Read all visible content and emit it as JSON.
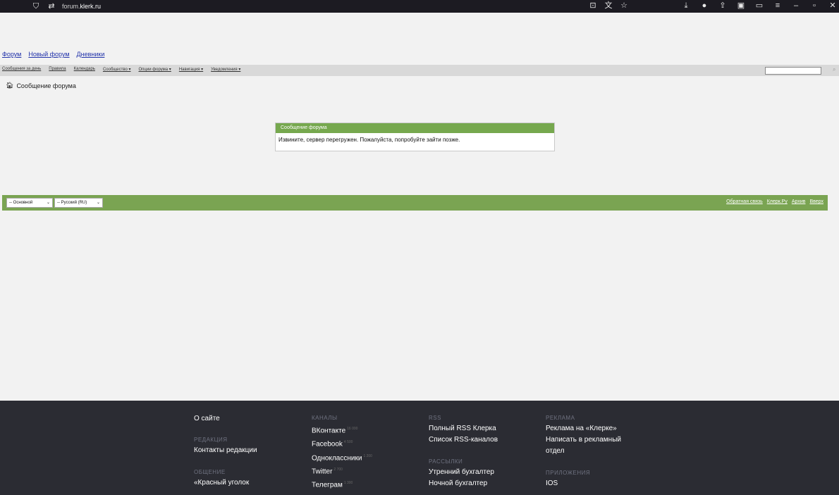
{
  "browser": {
    "url_prefix": "forum.",
    "url_domain": "klerk.ru"
  },
  "top_links": [
    "Форум",
    "Новый форум",
    "Дневники"
  ],
  "nav_items": [
    "Сообщения за день",
    "Правила",
    "Календарь",
    "Сообщество ▾",
    "Опции форума ▾",
    "Навигация ▾",
    "Уведомления ▾"
  ],
  "breadcrumb": "Сообщение форума",
  "message": {
    "title": "Сообщение форума",
    "text": "Извините, сервер перегружен. Пожалуйста, попробуйте зайти позже."
  },
  "footer_bar": {
    "style_select": "-- Основной",
    "language_select": "-- Русский (RU)",
    "links": [
      "Обратная связь",
      "Клерк.Ру",
      "Архив",
      "Вверх"
    ]
  },
  "footer": {
    "col1": {
      "item1": "О сайте",
      "title2": "РЕДАКЦИЯ",
      "item2": "Контакты редакции",
      "title3": "ОБЩЕНИЕ",
      "item3": "«Красный уголок"
    },
    "col2": {
      "title": "КАНАЛЫ",
      "items": [
        {
          "name": "ВКонтакте",
          "count": "16 000"
        },
        {
          "name": "Facebook",
          "count": "4 500"
        },
        {
          "name": "Одноклассники",
          "count": "1 200"
        },
        {
          "name": "Twitter",
          "count": "2 700"
        },
        {
          "name": "Телеграм",
          "count": "1 300"
        }
      ]
    },
    "col3": {
      "title": "RSS",
      "items": [
        "Полный RSS Клерка",
        "Список RSS-каналов"
      ],
      "title2": "РАССЫЛКИ",
      "items2": [
        "Утренний бухгалтер",
        "Ночной бухгалтер"
      ]
    },
    "col4": {
      "title": "РЕКЛАМА",
      "items": [
        "Реклама на «Клерке»",
        "Написать в рекламный",
        "отдел"
      ],
      "title2": "ПРИЛОЖЕНИЯ",
      "items2": [
        "IOS"
      ]
    }
  }
}
